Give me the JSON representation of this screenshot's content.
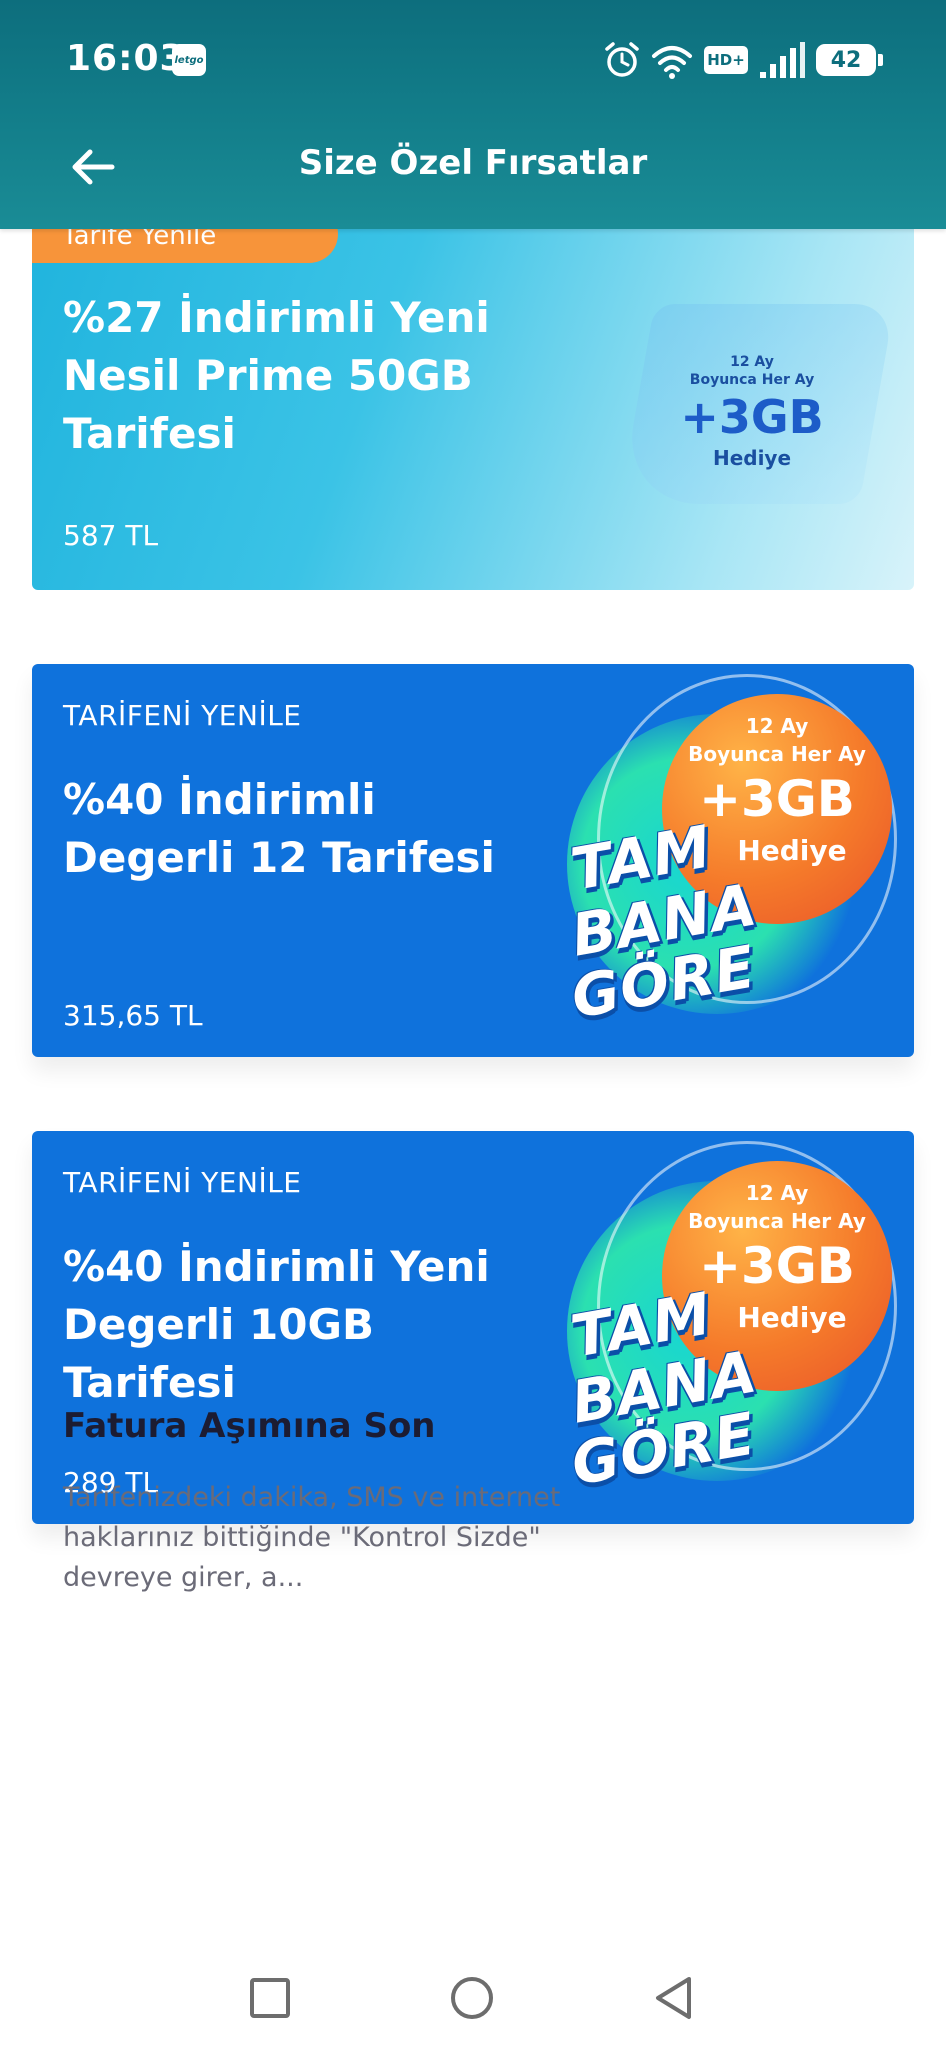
{
  "status_bar": {
    "time": "16:03",
    "app_badge": "letgo",
    "network_badge": "HD+",
    "battery": "42",
    "icons": [
      "alarm-icon",
      "wifi-icon",
      "signal-icon",
      "battery-icon"
    ]
  },
  "header": {
    "title": "Size Özel Fırsatlar",
    "background": "#137f8b"
  },
  "offers": [
    {
      "tag": "Tarife Yenile",
      "title_lines": [
        "%27 İndirimli Yeni",
        "Nesil Prime 50GB",
        "Tarifesi"
      ],
      "price": "587 TL",
      "promo": {
        "line1": "12 Ay",
        "line2": "Boyunca Her Ay",
        "big": "+3GB",
        "gift": "Hediye"
      }
    },
    {
      "tag": "TARİFENİ YENİLE",
      "title_lines": [
        "%40 İndirimli",
        "Degerli 12 Tarifesi"
      ],
      "price": "315,65 TL",
      "promo": {
        "line1": "12 Ay",
        "line2": "Boyunca Her Ay",
        "big": "+3GB",
        "gift": "Hediye",
        "brand": [
          "TAM",
          "BANA",
          "GÖRE"
        ]
      }
    },
    {
      "tag": "TARİFENİ YENİLE",
      "title_lines": [
        "%40 İndirimli Yeni",
        "Degerli 10GB",
        "Tarifesi"
      ],
      "price": "289 TL",
      "promo": {
        "line1": "12 Ay",
        "line2": "Boyunca Her Ay",
        "big": "+3GB",
        "gift": "Hediye",
        "brand": [
          "TAM",
          "BANA",
          "GÖRE"
        ]
      }
    }
  ],
  "info": {
    "title": "Fatura Aşımına Son",
    "body": "Tarifenizdeki dakika, SMS ve internet haklarınız bittiğinde \"Kontrol Sizde\" devreye girer, a..."
  },
  "colors": {
    "card_blue": "#0f72dc",
    "tag_orange": "#f7943a",
    "promo_orange": "#f57a2a",
    "promo_teal": "#2be0b0"
  },
  "nav_bar": [
    "recents-button",
    "home-button",
    "back-button"
  ]
}
